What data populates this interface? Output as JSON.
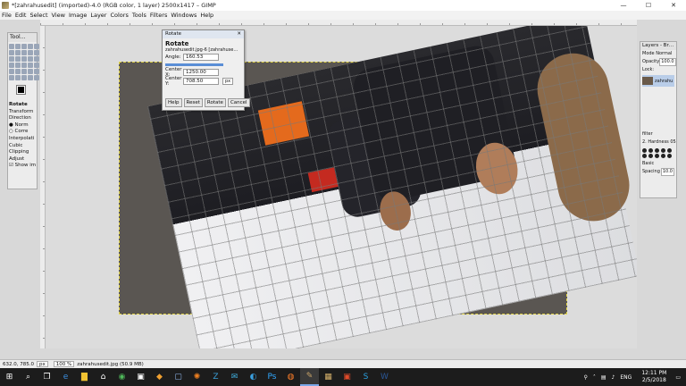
{
  "window": {
    "title": "*[zahrahusedit] (imported)-4.0 (RGB color, 1 layer) 2500x1417 – GIMP",
    "minimize": "—",
    "maximize": "☐",
    "close": "✕"
  },
  "menu": [
    "File",
    "Edit",
    "Select",
    "View",
    "Image",
    "Layer",
    "Colors",
    "Tools",
    "Filters",
    "Windows",
    "Help"
  ],
  "toolbox": {
    "title": "Tool…",
    "options": [
      {
        "text": "Rotate",
        "bold": true
      },
      {
        "text": "Transform",
        "bold": false
      },
      {
        "text": "Direction",
        "bold": false
      },
      {
        "text": "● Norm",
        "bold": false
      },
      {
        "text": "○ Corre",
        "bold": false
      },
      {
        "text": "Interpolati",
        "bold": false
      },
      {
        "text": "Cubic",
        "bold": false
      },
      {
        "text": "Clipping",
        "bold": false
      },
      {
        "text": "Adjust",
        "bold": false
      },
      {
        "text": "☑ Show im",
        "bold": false
      }
    ]
  },
  "rotate_dialog": {
    "header": "Rotate",
    "title": "Rotate",
    "subtitle": "zahrahusedit.jpg-6 [zahrahuse…",
    "angle_label": "Angle:",
    "angle_value": "160.53",
    "center_x_label": "Center X:",
    "center_x_value": "1250.00",
    "center_y_label": "Center Y:",
    "center_y_value": "708.50",
    "unit": "px",
    "buttons": [
      "Help",
      "Reset",
      "Rotate",
      "Cancel"
    ]
  },
  "layers_dock": {
    "title": "Layers - Br…",
    "mode_label": "Mode Normal",
    "opacity_label": "Opacity",
    "opacity_value": "100.0",
    "lock_label": "Lock:",
    "layer_name": "zahrahu",
    "filter_label": "filter",
    "brush_name": "2. Hardness 050 …",
    "preset": "Basic",
    "spacing_label": "Spacing",
    "spacing_value": "10.0"
  },
  "statusbar": {
    "coords": "632.0, 785.0",
    "unit": "px",
    "zoom": "100 %",
    "file": "zahrahusedit.jpg (50.9 MB)"
  },
  "taskbar": {
    "language": "ENG",
    "time": "12:11 PM",
    "date": "2/5/2018",
    "icons": [
      "windows-start-icon",
      "search-icon",
      "task-view-icon",
      "edge-icon",
      "file-explorer-icon",
      "store-icon",
      "chrome-icon",
      "media-player-icon",
      "maps-icon",
      "word-app-icon",
      "blender-icon",
      "app-z-icon",
      "vpn-icon",
      "mail-icon",
      "photoshop-icon",
      "firefox-icon",
      "gimp-icon",
      "archive-icon",
      "office-icon",
      "skype-icon",
      "ms-word-icon"
    ]
  },
  "colors": {
    "accent": "#5a8ed6",
    "taskbar": "#1c1c1c",
    "layer_select": "#b9cde8"
  }
}
